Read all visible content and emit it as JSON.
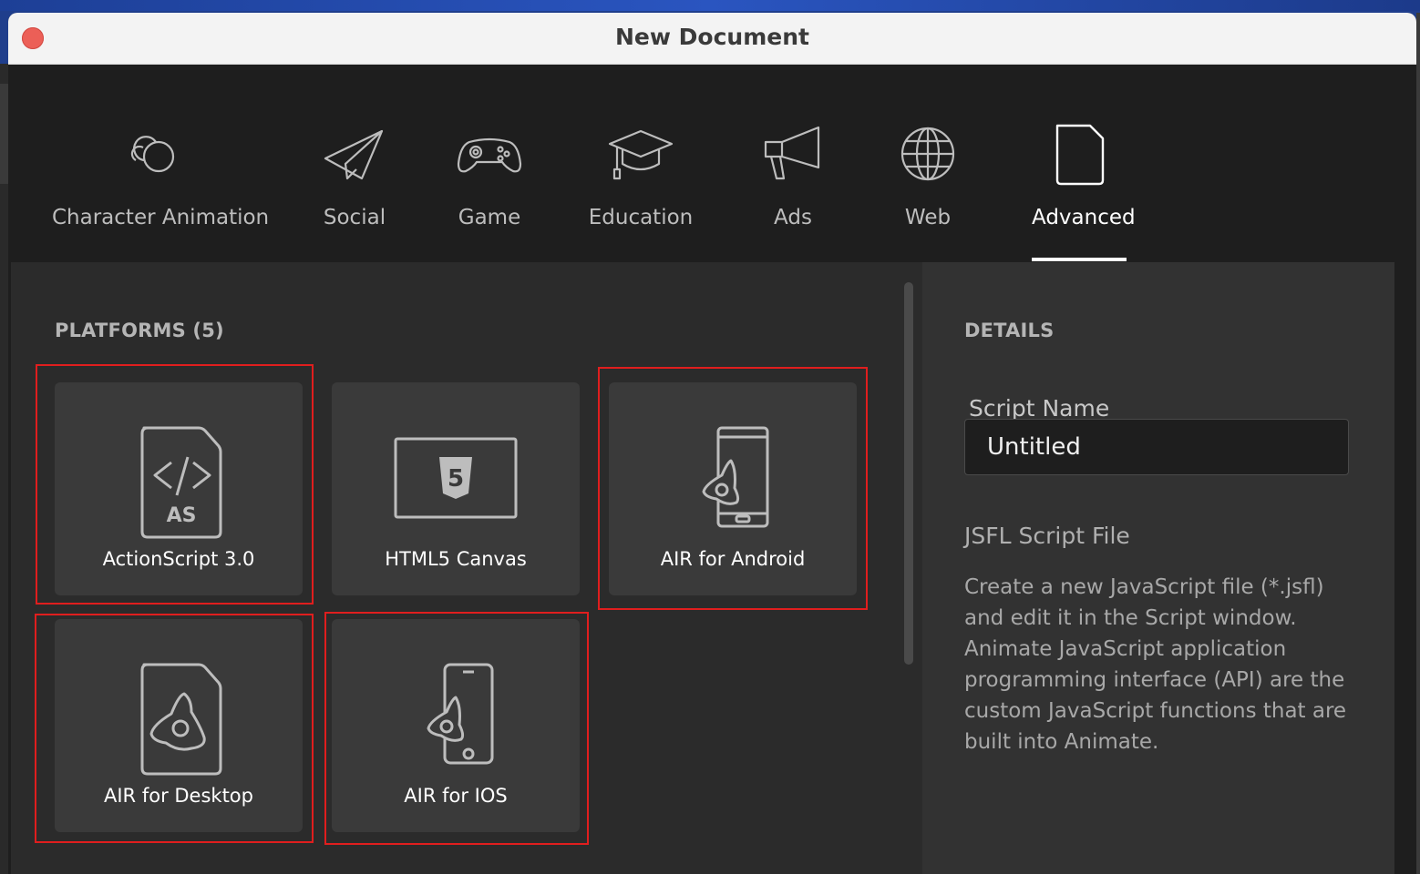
{
  "window": {
    "title": "New Document"
  },
  "categories": [
    {
      "label": "Character Animation",
      "icon": "character-animation-icon"
    },
    {
      "label": "Social",
      "icon": "paper-plane-icon"
    },
    {
      "label": "Game",
      "icon": "gamepad-icon"
    },
    {
      "label": "Education",
      "icon": "graduation-cap-icon"
    },
    {
      "label": "Ads",
      "icon": "megaphone-icon"
    },
    {
      "label": "Web",
      "icon": "globe-icon"
    },
    {
      "label": "Advanced",
      "icon": "document-icon",
      "active": true
    }
  ],
  "platforms": {
    "title": "PLATFORMS (5)",
    "items": [
      {
        "label": "ActionScript 3.0",
        "icon": "actionscript-file-icon",
        "icon_text": "AS"
      },
      {
        "label": "HTML5 Canvas",
        "icon": "html5-canvas-icon",
        "icon_text": "5"
      },
      {
        "label": "AIR for Android",
        "icon": "android-phone-icon"
      },
      {
        "label": "AIR for Desktop",
        "icon": "air-desktop-file-icon"
      },
      {
        "label": "AIR for IOS",
        "icon": "ios-phone-icon"
      }
    ]
  },
  "details": {
    "title": "DETAILS",
    "name_label": "Script Name",
    "name_value": "Untitled",
    "file_type": "JSFL Script File",
    "description": "Create a new JavaScript file (*.jsfl) and edit it in the Script window. Animate JavaScript application programming interface (API) are the custom JavaScript functions that are built into Animate."
  },
  "colors": {
    "highlight": "#e01e1e",
    "accent": "#ffffff",
    "close": "#ec5f57"
  }
}
